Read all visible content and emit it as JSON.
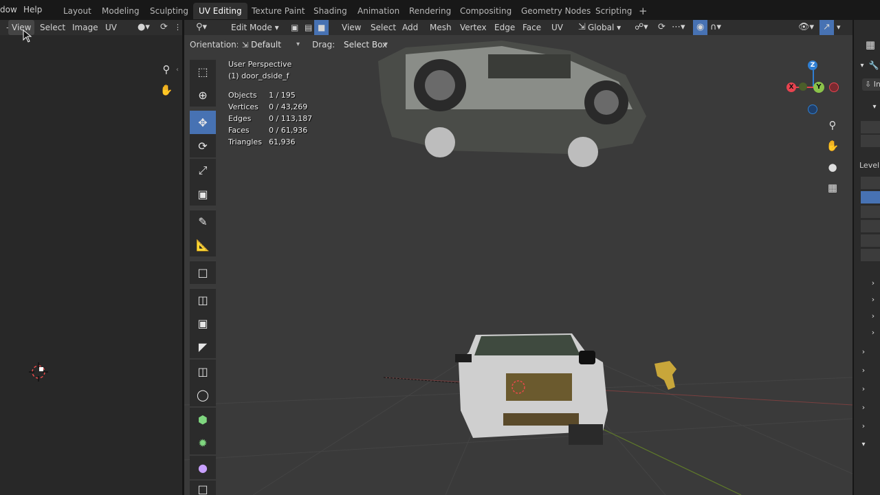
{
  "topbar": {
    "menu": [
      "dow",
      "Help"
    ],
    "workspaces": [
      "Layout",
      "Modeling",
      "Sculpting",
      "UV Editing",
      "Texture Paint",
      "Shading",
      "Animation",
      "Rendering",
      "Compositing",
      "Geometry Nodes",
      "Scripting"
    ],
    "active_workspace": "UV Editing",
    "add_tab": "+"
  },
  "uv_editor": {
    "menu": [
      "View",
      "Select",
      "Image",
      "UV"
    ]
  },
  "viewport": {
    "mode": "Edit Mode",
    "menu": [
      "View",
      "Select",
      "Add",
      "Mesh",
      "Vertex",
      "Edge",
      "Face",
      "UV"
    ],
    "transform_orientation": "Global",
    "orientation_label": "Orientation:",
    "orientation_value": "Default",
    "drag_label": "Drag:",
    "drag_value": "Select Box",
    "overlay_title": "User Perspective",
    "overlay_object": "(1) door_dside_f",
    "stats": [
      {
        "label": "Objects",
        "value": "1 / 195"
      },
      {
        "label": "Vertices",
        "value": "0 / 43,269"
      },
      {
        "label": "Edges",
        "value": "0 / 113,187"
      },
      {
        "label": "Faces",
        "value": "0 / 61,936"
      },
      {
        "label": "Triangles",
        "value": "61,936"
      }
    ],
    "gizmo": {
      "x": "X",
      "y": "Y",
      "z": "Z"
    },
    "colors": {
      "x": "#e8434f",
      "y": "#8bc34a",
      "z": "#2f7fd3",
      "active_tool": "#4772b3"
    }
  },
  "properties": {
    "partial_label_1": "In",
    "partial_label_2": "Level"
  }
}
